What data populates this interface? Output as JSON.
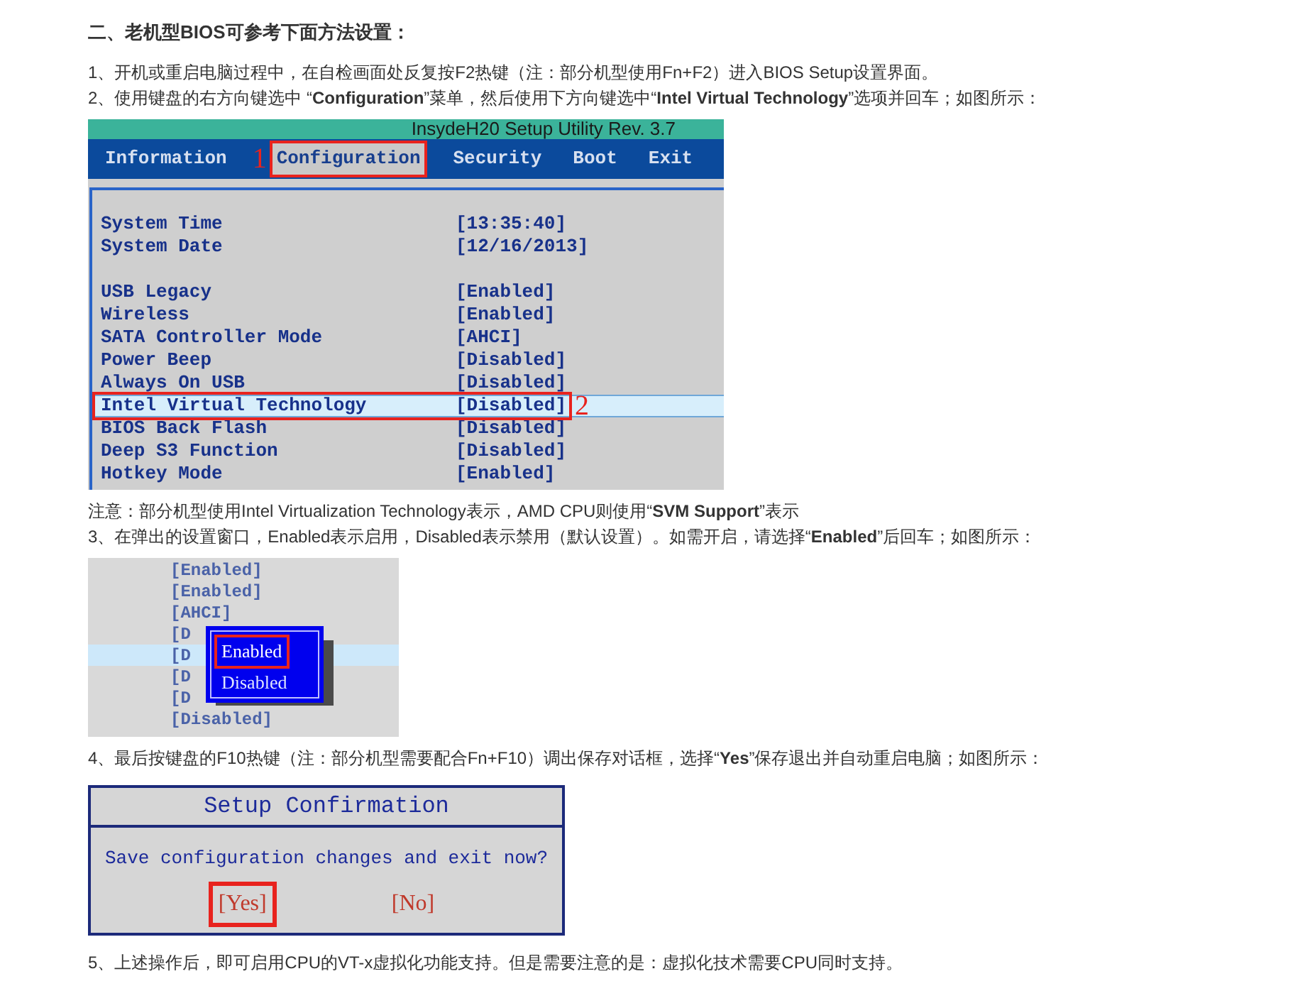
{
  "blocks": [
    {
      "kind": "heading",
      "text": "二、老机型BIOS可参考下面方法设置："
    },
    {
      "kind": "paragraph",
      "text": "1、开机或重启电脑过程中，在自检画面处反复按F2热键（注：部分机型使用Fn+F2）进入BIOS Setup设置界面。"
    },
    {
      "kind": "paragraph",
      "text": "2、使用键盘的右方向键选中 “**Configuration**”菜单，然后使用下方向键选中“**Intel Virtual Technology**”选项并回车；如图所示："
    },
    {
      "kind": "bios_setup",
      "title": "InsydeH20 Setup Utility Rev. 3.7",
      "menu": [
        {
          "label": "Information",
          "selected": false
        },
        {
          "label": "Configuration",
          "selected": true,
          "marker": "1"
        },
        {
          "label": "Security",
          "selected": false
        },
        {
          "label": "Boot",
          "selected": false
        },
        {
          "label": "Exit",
          "selected": false
        }
      ],
      "groups": [
        [
          {
            "label": "System Time",
            "value": "[13:35:40]",
            "selected": false
          },
          {
            "label": "System Date",
            "value": "[12/16/2013]",
            "selected": false
          }
        ],
        [
          {
            "label": "USB Legacy",
            "value": "[Enabled]",
            "selected": false
          },
          {
            "label": "Wireless",
            "value": "[Enabled]",
            "selected": false
          },
          {
            "label": "SATA Controller Mode",
            "value": "[AHCI]",
            "selected": false
          },
          {
            "label": "Power Beep",
            "value": "[Disabled]",
            "selected": false
          },
          {
            "label": "Always On USB",
            "value": "[Disabled]",
            "selected": false
          },
          {
            "label": "Intel Virtual Technology",
            "value": "[Disabled]",
            "selected": true,
            "marker": "2"
          },
          {
            "label": "BIOS Back Flash",
            "value": "[Disabled]",
            "selected": false
          },
          {
            "label": "Deep S3 Function",
            "value": "[Disabled]",
            "selected": false
          },
          {
            "label": "Hotkey Mode",
            "value": "[Enabled]",
            "selected": false
          }
        ]
      ]
    },
    {
      "kind": "paragraph",
      "text": "注意：部分机型使用Intel Virtualization Technology表示，AMD CPU则使用“**SVM Support**”表示"
    },
    {
      "kind": "paragraph",
      "text": "3、在弹出的设置窗口，Enabled表示启用，Disabled表示禁用（默认设置）。如需开启，请选择“**Enabled**”后回车；如图所示："
    },
    {
      "kind": "value_popup",
      "values": [
        {
          "text": "[Enabled]",
          "selected": false
        },
        {
          "text": "[Enabled]",
          "selected": false
        },
        {
          "text": "[AHCI]",
          "selected": false
        },
        {
          "text": "[D",
          "selected": false
        },
        {
          "text": "[D",
          "selected": true
        },
        {
          "text": "[D",
          "selected": false
        },
        {
          "text": "[D",
          "selected": false
        },
        {
          "text": "[Disabled]",
          "selected": false
        }
      ],
      "options": [
        {
          "label": "Enabled",
          "selected": true
        },
        {
          "label": "Disabled",
          "selected": false
        }
      ]
    },
    {
      "kind": "paragraph",
      "text": "4、最后按键盘的F10热键（注：部分机型需要配合Fn+F10）调出保存对话框，选择“**Yes**”保存退出并自动重启电脑；如图所示："
    },
    {
      "kind": "confirm_dialog",
      "title": "Setup Confirmation",
      "message": "Save configuration changes and exit now?",
      "buttons": [
        {
          "label": "[Yes]",
          "selected": true
        },
        {
          "label": "[No]",
          "selected": false
        }
      ]
    },
    {
      "kind": "paragraph",
      "text": "5、上述操作后，即可启用CPU的VT-x虚拟化功能支持。但是需要注意的是：虚拟化技术需要CPU同时支持。"
    }
  ]
}
